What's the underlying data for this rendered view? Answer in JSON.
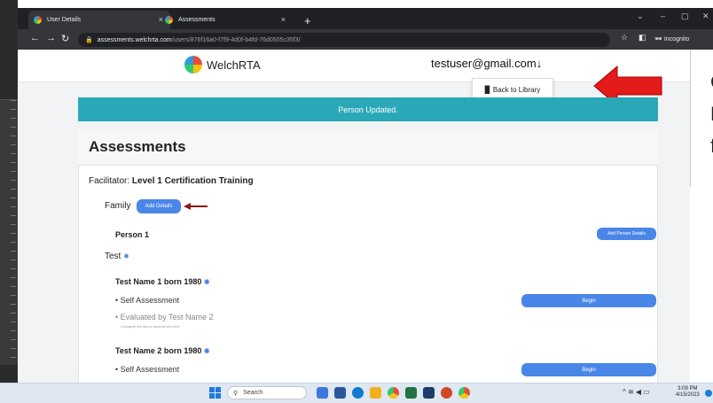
{
  "browser": {
    "tabs": [
      {
        "label": "User Details",
        "close": "×"
      },
      {
        "label": "Assessments",
        "close": "×"
      }
    ],
    "new_tab": "+",
    "url_host": "assessments.welchrta.com",
    "url_path": "/users/876f16a0-f7f9-4d0f-b4fd-76d0505c35f3/",
    "incognito_label": "Incognito"
  },
  "header": {
    "brand": "WelchRTA",
    "user_email": "testuser@gmail.com",
    "menu_item": "Back to Library"
  },
  "banner": {
    "text": "Person Updated."
  },
  "assessments": {
    "title": "Assessments",
    "facilitator_label": "Facilitator:",
    "facilitator_name": "Level 1 Certification Training",
    "family_label": "Family",
    "add_details": "Add Details",
    "person_label": "Person 1",
    "add_person_details": "Add Person Details",
    "group_name": "Test",
    "people": [
      {
        "name": "Test Name 1 born 1980",
        "self_assessment": "• Self Assessment",
        "begin": "Begin",
        "evaluated": "• Evaluated by Test Name 2",
        "note": "Complete the above assessment first"
      },
      {
        "name": "Test Name 2 born 1980",
        "self_assessment": "• Self Assessment",
        "begin": "Begin"
      }
    ]
  },
  "slide_text": [
    "C",
    "L",
    "f"
  ],
  "taskbar": {
    "search": "Search",
    "time": "3:09 PM",
    "date": "4/15/2023"
  },
  "colors": {
    "accent": "#4a86e8",
    "banner": "#2aa8b8",
    "callout_red": "#e31b1b"
  }
}
